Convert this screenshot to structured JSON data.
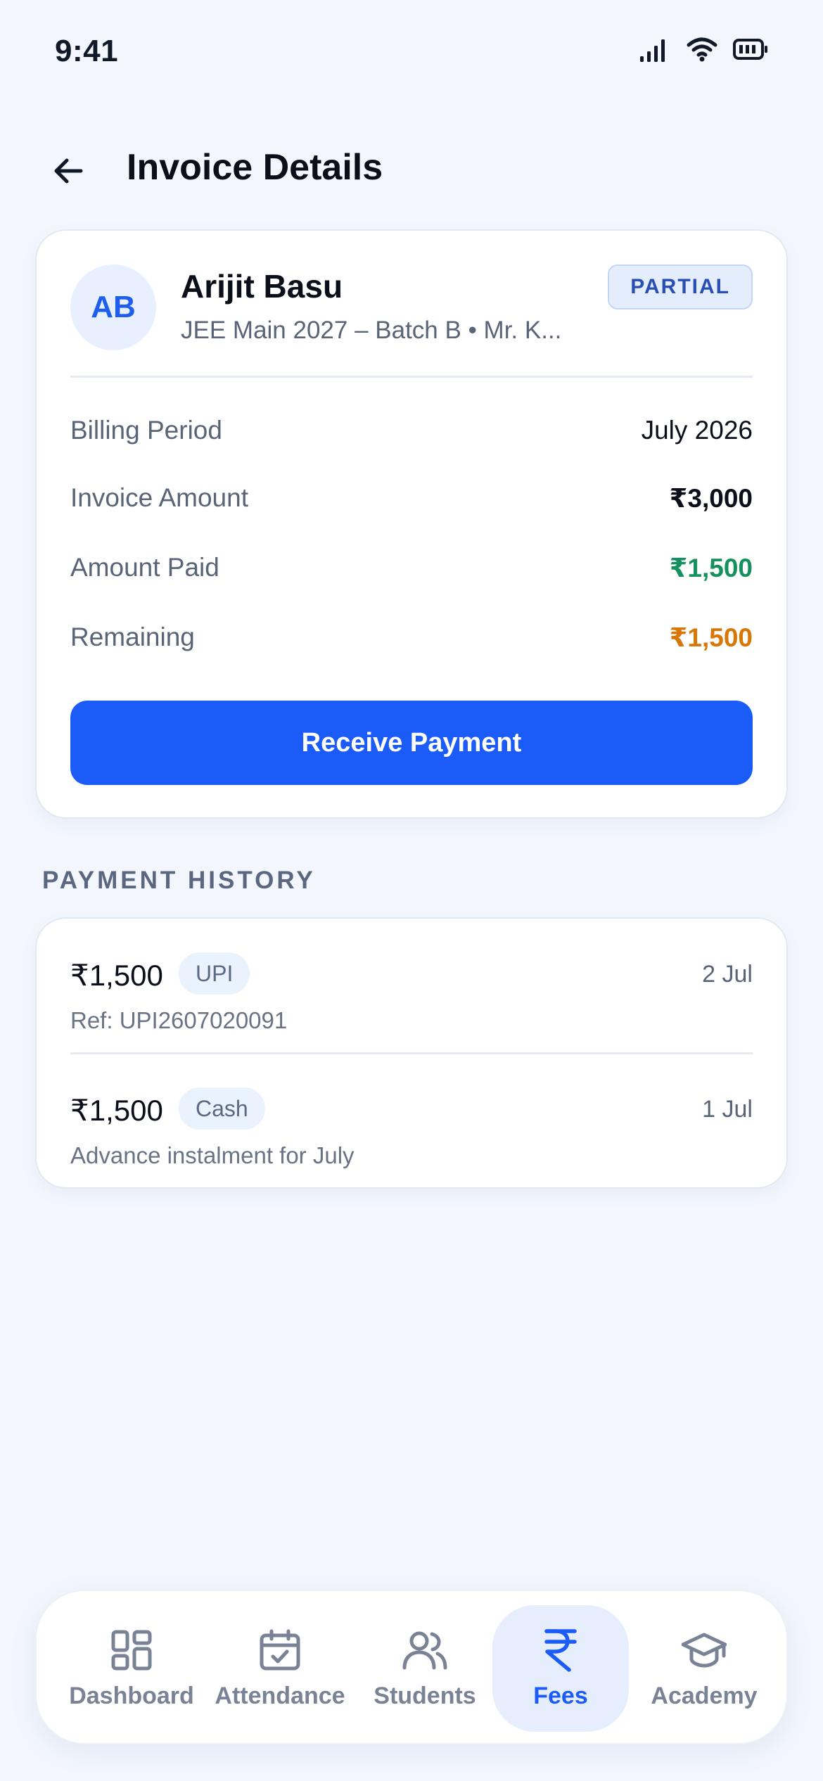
{
  "status_bar": {
    "time": "9:41"
  },
  "header": {
    "title": "Invoice Details"
  },
  "invoice": {
    "avatar_initials": "AB",
    "student_name": "Arijit Basu",
    "subtitle": "JEE Main 2027 – Batch B • Mr. K...",
    "status": "PARTIAL",
    "rows": [
      {
        "label": "Billing Period",
        "value": "July 2026"
      },
      {
        "label": "Invoice Amount",
        "value": "₹3,000"
      },
      {
        "label": "Amount Paid",
        "value": "₹1,500"
      },
      {
        "label": "Remaining",
        "value": "₹1,500"
      }
    ],
    "action_label": "Receive Payment"
  },
  "payment_history": {
    "title": "PAYMENT HISTORY",
    "entries": [
      {
        "amount": "₹1,500",
        "method": "UPI",
        "date": "2 Jul",
        "note": "Ref: UPI2607020091"
      },
      {
        "amount": "₹1,500",
        "method": "Cash",
        "date": "1 Jul",
        "note": "Advance instalment for July"
      }
    ]
  },
  "nav": {
    "active": "Fees",
    "items": [
      {
        "label": "Dashboard",
        "icon": "dashboard-icon"
      },
      {
        "label": "Attendance",
        "icon": "calendar-check-icon"
      },
      {
        "label": "Students",
        "icon": "users-icon"
      },
      {
        "label": "Fees",
        "icon": "rupee-icon"
      },
      {
        "label": "Academy",
        "icon": "graduation-cap-icon"
      }
    ]
  },
  "colors": {
    "primary": "#1b5cf8",
    "paid_green": "#15915f",
    "remaining_orange": "#d97706",
    "background": "#f3f7fd"
  }
}
